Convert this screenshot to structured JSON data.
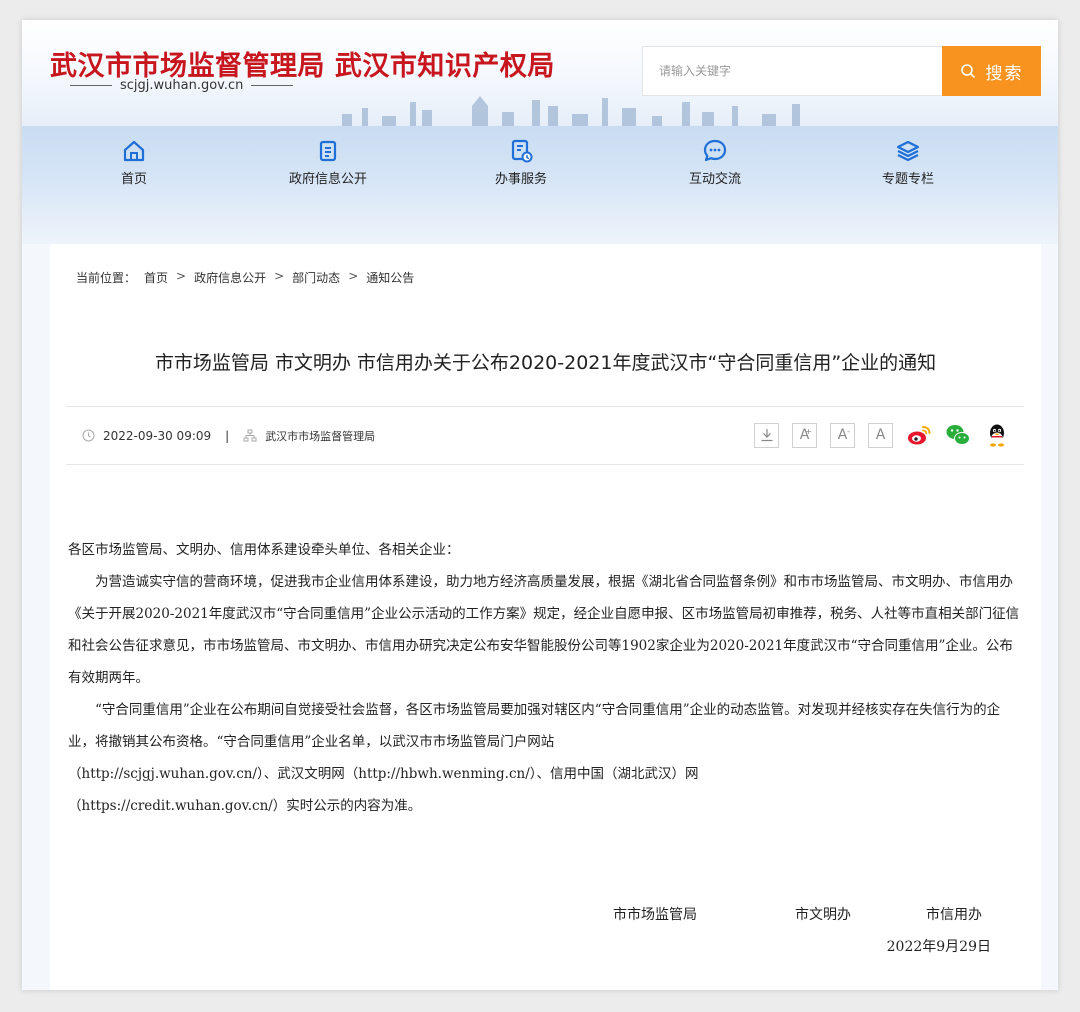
{
  "header": {
    "title": "武汉市市场监督管理局 武汉市知识产权局",
    "domain": "scjgj.wuhan.gov.cn",
    "search": {
      "placeholder": "请输入关键字",
      "button_label": "搜索"
    }
  },
  "nav": {
    "items": [
      {
        "label": "首页",
        "icon": "home-icon"
      },
      {
        "label": "政府信息公开",
        "icon": "document-icon"
      },
      {
        "label": "办事服务",
        "icon": "service-icon"
      },
      {
        "label": "互动交流",
        "icon": "chat-icon"
      },
      {
        "label": "专题专栏",
        "icon": "layers-icon"
      }
    ]
  },
  "breadcrumb": {
    "prefix": "当前位置：",
    "items": [
      "首页",
      "政府信息公开",
      "部门动态",
      "通知公告"
    ],
    "separator": ">"
  },
  "article": {
    "title": "市市场监管局 市文明办 市信用办关于公布2020-2021年度武汉市“守合同重信用”企业的通知",
    "date": "2022-09-30 09:09",
    "meta_divider": "|",
    "source": "武汉市市场监督管理局",
    "tools": {
      "font_large": "A",
      "font_medium": "A",
      "font_small": "A"
    },
    "salutation": "各区市场监管局、文明办、信用体系建设牵头单位、各相关企业：",
    "paragraphs": [
      "为营造诚实守信的营商环境，促进我市企业信用体系建设，助力地方经济高质量发展，根据《湖北省合同监督条例》和市市场监管局、市文明办、市信用办《关于开展2020-2021年度武汉市“守合同重信用”企业公示活动的工作方案》规定，经企业自愿申报、区市场监管局初审推荐，税务、人社等市直相关部门征信和社会公告征求意见，市市场监管局、市文明办、市信用办研究决定公布安华智能股份公司等1902家企业为2020-2021年度武汉市“守合同重信用”企业。公布有效期两年。",
      "“守合同重信用”企业在公布期间自觉接受社会监督，各区市场监管局要加强对辖区内“守合同重信用”企业的动态监管。对发现并经核实存在失信行为的企业，将撤销其公布资格。“守合同重信用”企业名单，以武汉市市场监管局门户网站"
    ],
    "links": [
      "（http://scjgj.wuhan.gov.cn/）、武汉文明网（http://hbwh.wenming.cn/）、信用中国（湖北武汉）网",
      "（https://credit.wuhan.gov.cn/）实时公示的内容为准。"
    ],
    "signature": {
      "orgs": [
        "市市场监管局",
        "市文明办",
        "市信用办"
      ],
      "date": "2022年9月29日"
    }
  },
  "colors": {
    "brand_red": "#c8161e",
    "search_orange": "#f7931e",
    "nav_icon_blue": "#1f6fd6",
    "weibo_red": "#e6162d",
    "weibo_yellow": "#f6a800",
    "wechat_green": "#2aae3b"
  }
}
